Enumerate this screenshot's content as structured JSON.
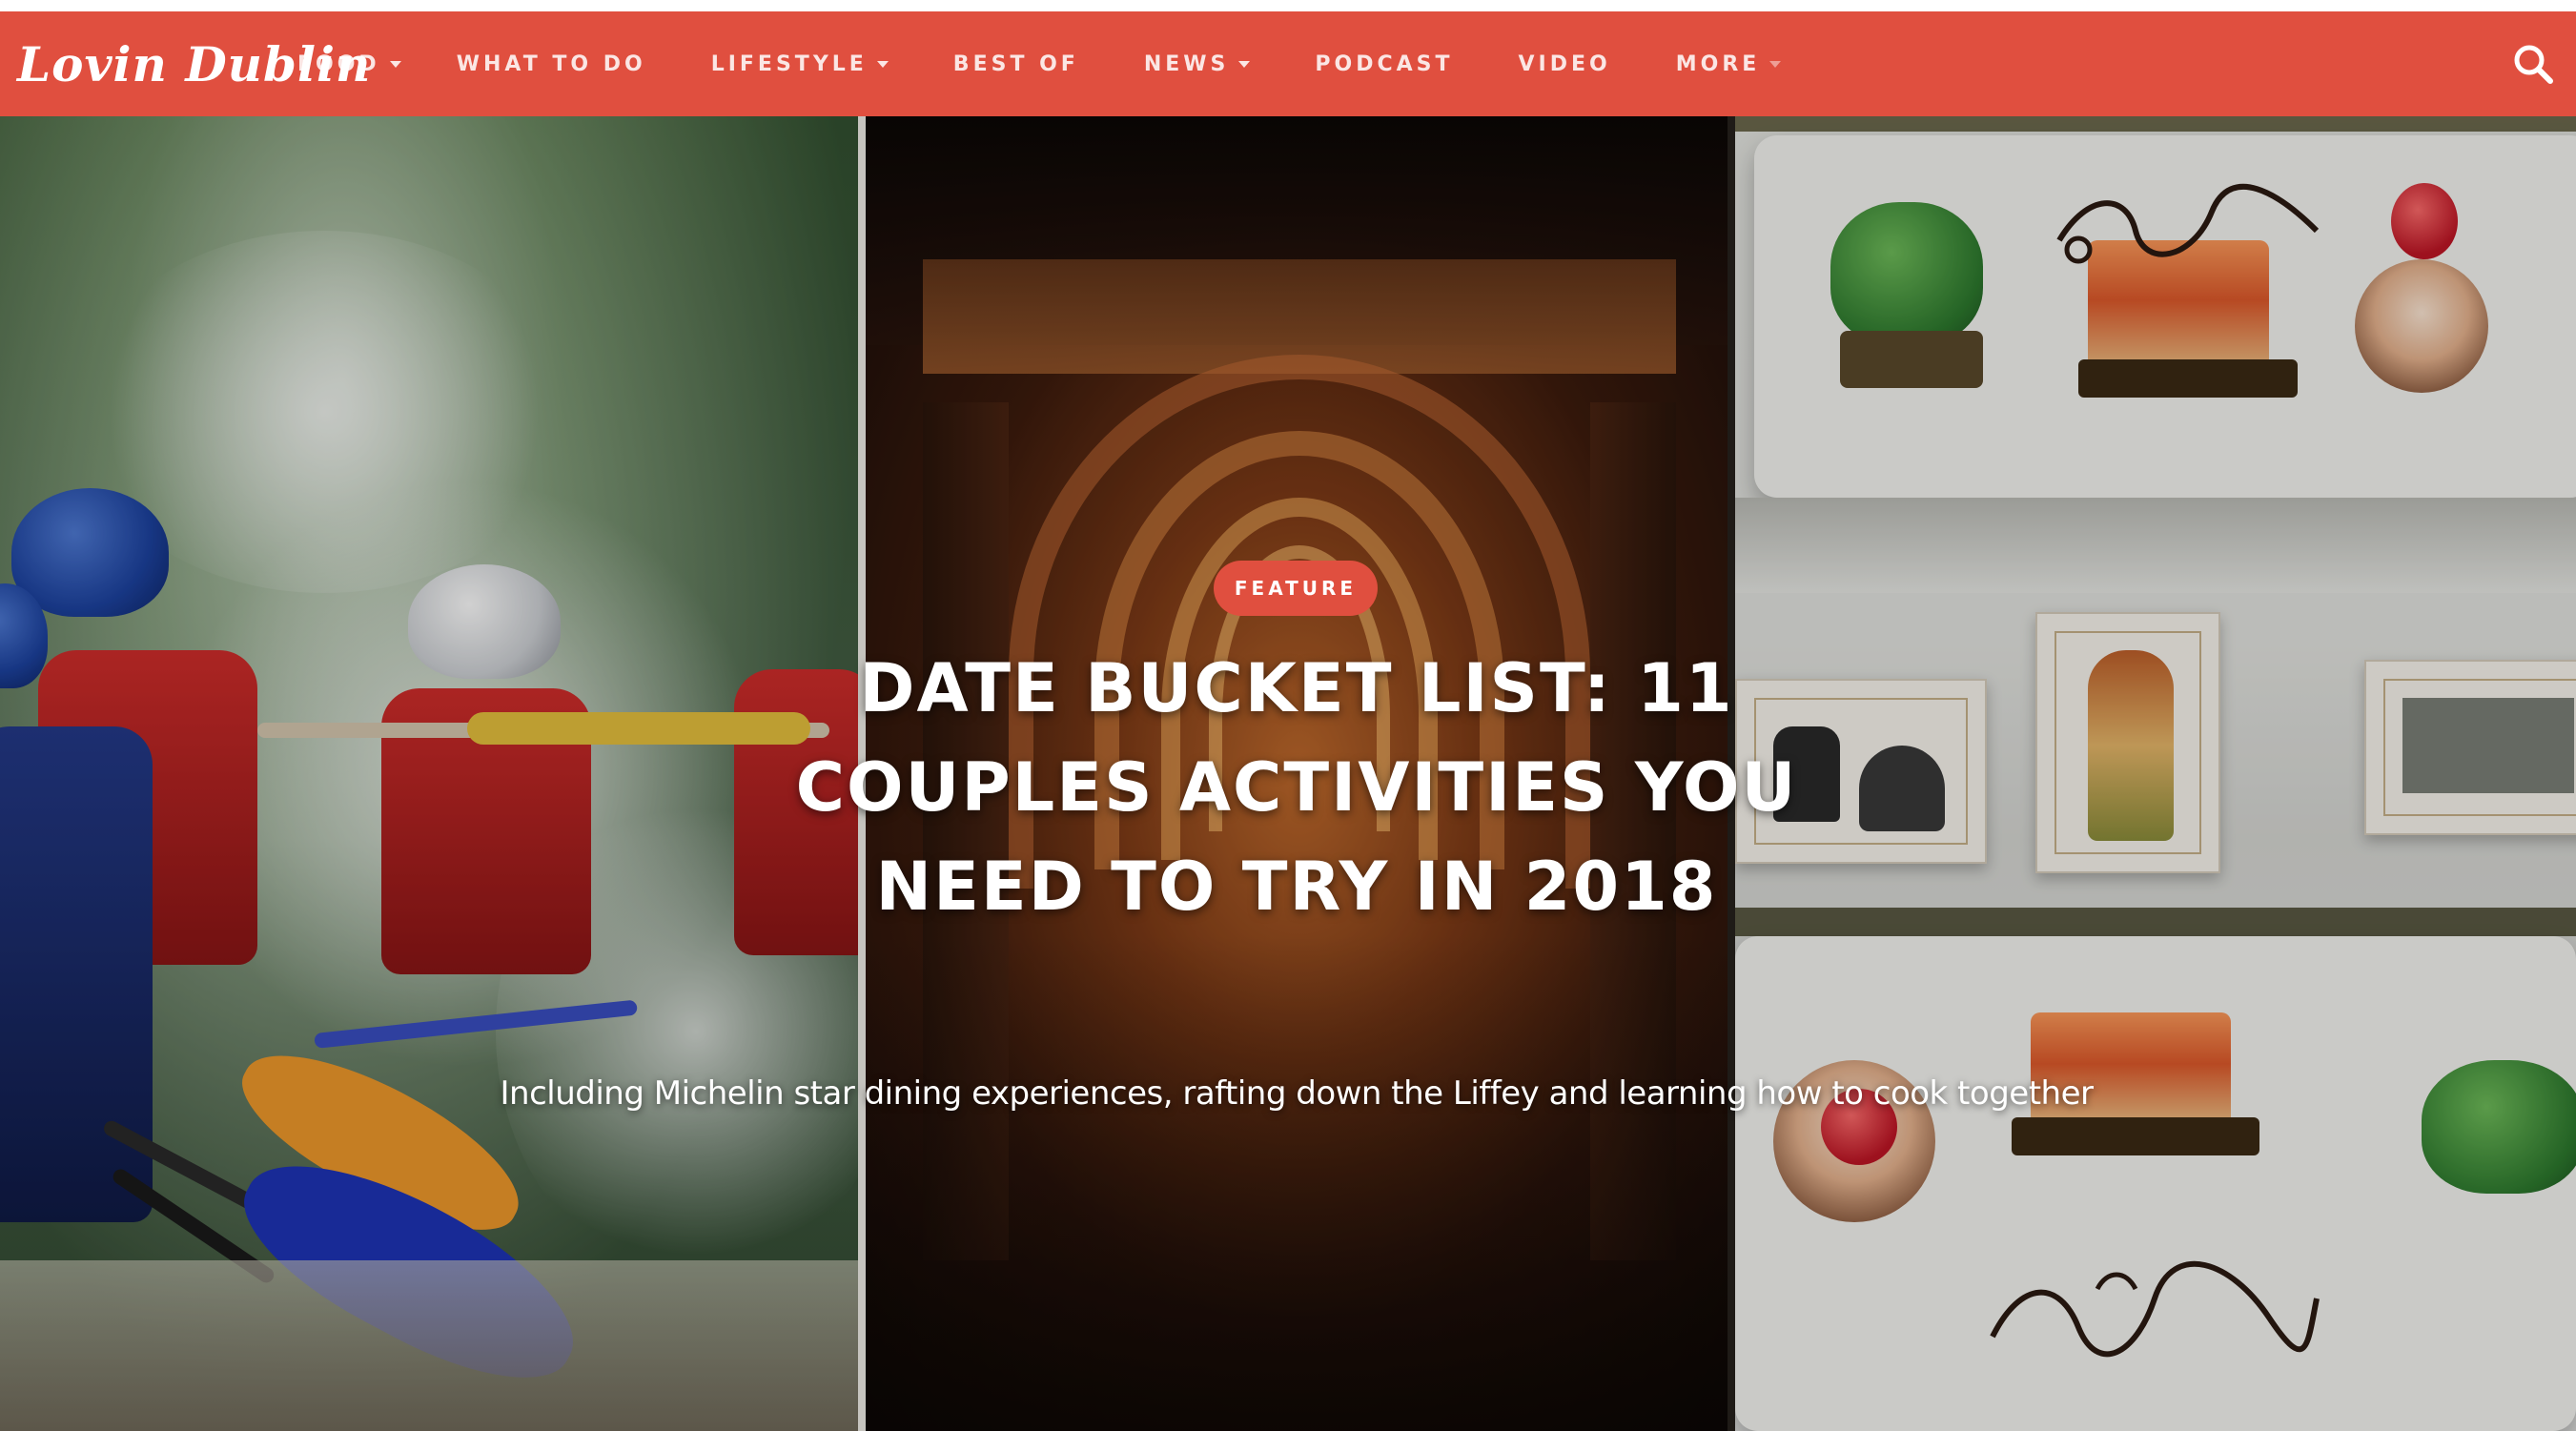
{
  "site": {
    "logo_text": "Lovin Dublin"
  },
  "nav": {
    "items": [
      {
        "label": "FOOD",
        "has_dropdown": true
      },
      {
        "label": "WHAT TO DO",
        "has_dropdown": false
      },
      {
        "label": "LIFESTYLE",
        "has_dropdown": true
      },
      {
        "label": "BEST OF",
        "has_dropdown": false
      },
      {
        "label": "NEWS",
        "has_dropdown": true
      },
      {
        "label": "PODCAST",
        "has_dropdown": false
      },
      {
        "label": "VIDEO",
        "has_dropdown": false
      },
      {
        "label": "MORE",
        "has_dropdown": true
      }
    ],
    "search_icon": "search-icon"
  },
  "hero": {
    "badge": "FEATURE",
    "headline": "DATE BUCKET LIST: 11 COUPLES ACTIVITIES YOU NEED TO TRY IN 2018",
    "subheadline": "Including Michelin star dining experiences, rafting down the Liffey and learning how to cook together"
  },
  "colors": {
    "brand_red": "#e04f3f",
    "text_white": "#ffffff"
  }
}
